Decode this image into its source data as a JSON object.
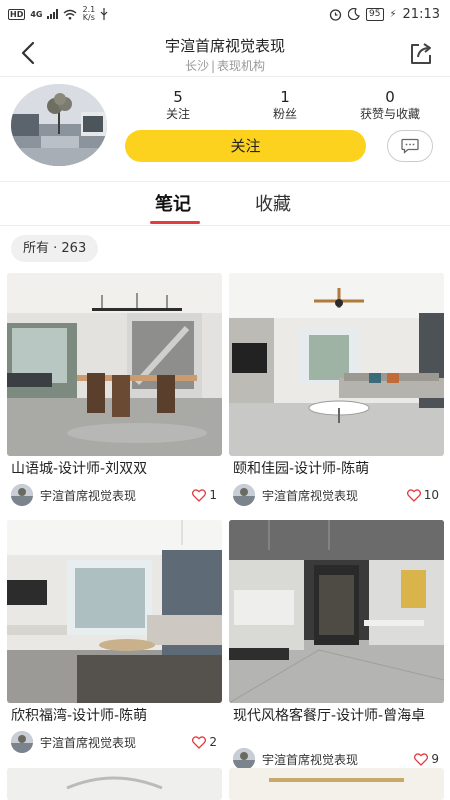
{
  "status_bar": {
    "network_hd": "HD",
    "network_type": "4G",
    "speed_value": "2.1",
    "speed_unit": "K/s",
    "battery": "95",
    "time": "21:13"
  },
  "header": {
    "title": "宇渲首席视觉表现",
    "location": "长沙",
    "separator": "|",
    "category": "表现机构"
  },
  "profile": {
    "stats": [
      {
        "value": "5",
        "label": "关注"
      },
      {
        "value": "1",
        "label": "粉丝"
      },
      {
        "value": "0",
        "label": "获赞与收藏"
      }
    ],
    "follow_label": "关注"
  },
  "tabs": [
    {
      "label": "笔记",
      "active": true
    },
    {
      "label": "收藏",
      "active": false
    }
  ],
  "filter": {
    "label": "所有 · 263"
  },
  "notes": [
    {
      "title": "山语城-设计师-刘双双",
      "author": "宇渲首席视觉表现",
      "likes": "1"
    },
    {
      "title": "颐和佳园-设计师-陈萌",
      "author": "宇渲首席视觉表现",
      "likes": "10"
    },
    {
      "title": "欣积福湾-设计师-陈萌",
      "author": "宇渲首席视觉表现",
      "likes": "2"
    },
    {
      "title": "现代风格客餐厅-设计师-曾海卓",
      "author": "宇渲首席视觉表现",
      "likes": "9"
    }
  ],
  "colors": {
    "accent_yellow": "#fdd21f",
    "tab_underline_red": "#e33b3f",
    "heart_red": "#e33b3f"
  },
  "icons": [
    "back-arrow-icon",
    "share-icon",
    "chat-bubble-icon",
    "heart-icon",
    "alarm-icon",
    "moon-icon",
    "wifi-icon",
    "usb-icon"
  ]
}
